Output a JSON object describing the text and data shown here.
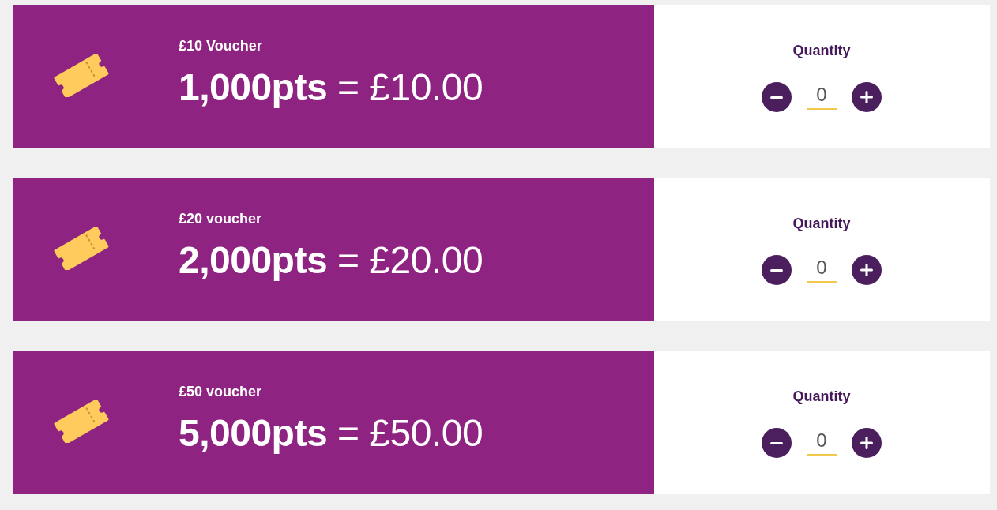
{
  "vouchers": [
    {
      "title": "£10 Voucher",
      "price": "**1,000pts** = £10.00",
      "quantity_label": "Quantity",
      "quantity": "0"
    },
    {
      "title": "£20 voucher",
      "price": "**2,000pts** = £20.00",
      "quantity_label": "Quantity",
      "quantity": "0"
    },
    {
      "title": "£50 voucher",
      "price": "**5,000pts** = £50.00",
      "quantity_label": "Quantity",
      "quantity": "0"
    }
  ]
}
